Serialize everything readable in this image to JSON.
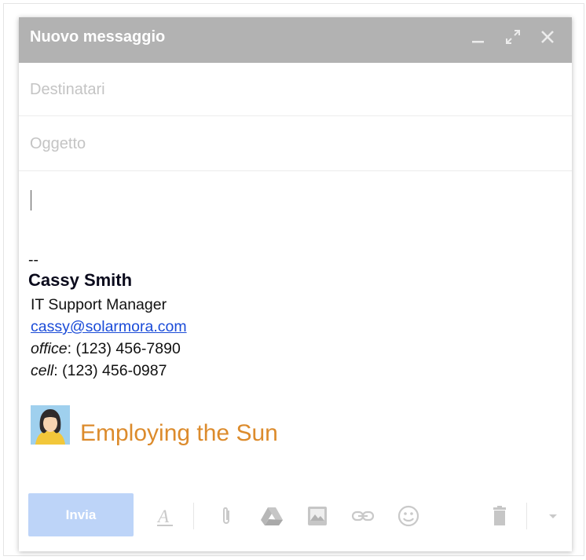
{
  "window": {
    "title": "Nuovo messaggio",
    "icons": [
      "minimize-icon",
      "expand-icon",
      "close-icon"
    ]
  },
  "fields": {
    "recipients_placeholder": "Destinatari",
    "subject_placeholder": "Oggetto"
  },
  "signature": {
    "separator": "--",
    "name": "Cassy Smith",
    "role": "IT Support Manager",
    "email": "cassy@solarmora.com",
    "office_label": "office",
    "office_value": ": (123) 456-7890",
    "cell_label": "cell",
    "cell_value": ": (123) 456-0987",
    "tagline": "Employing the Sun"
  },
  "toolbar": {
    "send_label": "Invia",
    "tools": [
      "format-text-icon",
      "attach-icon",
      "drive-icon",
      "photo-icon",
      "link-icon",
      "emoji-icon",
      "trash-icon",
      "more-options-icon"
    ]
  },
  "colors": {
    "titlebar": "#b2b2b2",
    "send_button": "#bdd4f8",
    "link": "#1a4bd8",
    "tagline": "#dc8b2c"
  }
}
